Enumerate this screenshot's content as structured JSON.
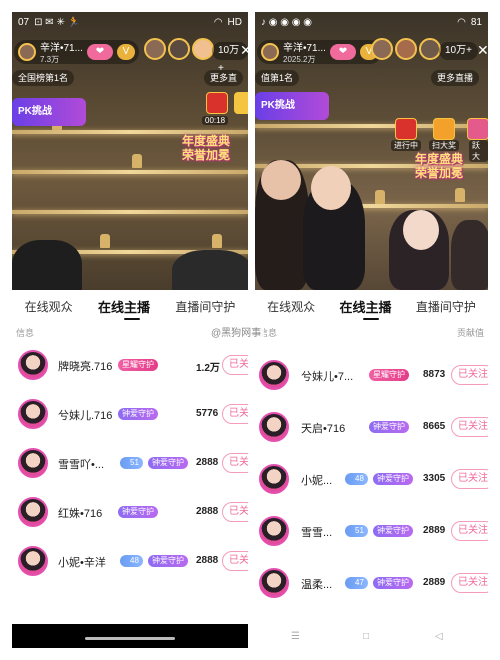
{
  "left": {
    "status": {
      "time": "07",
      "signal": "HD",
      "icons": "⊡ ✉ ✳ 🏃"
    },
    "anchor": {
      "name": "辛洋•71...",
      "heat": "7.3万"
    },
    "viewer_count": "10万+",
    "close_glyph": "✕",
    "rank_label": "全国榜第1名",
    "more_label": "更多直",
    "pk_label": "PK挑战",
    "promo_time": "00:18",
    "festival_line1": "年度盛典",
    "festival_line2": "荣誉加冕",
    "tabs": [
      "在线观众",
      "在线主播",
      "直播间守护"
    ],
    "subheader_left": "信息",
    "rows": [
      {
        "name": "牌晓亮.716",
        "level": "",
        "guard": "星耀守护",
        "guard_type": "star",
        "value": "1.2万",
        "follow": "已关"
      },
      {
        "name": "兮妹儿.716",
        "level": "",
        "guard": "钟爱守护",
        "guard_type": "bell",
        "value": "5776",
        "follow": "已关"
      },
      {
        "name": "雪雪吖•...",
        "level": "51",
        "guard": "钟爱守护",
        "guard_type": "bell",
        "value": "2888",
        "follow": "已关"
      },
      {
        "name": "红姝•716",
        "level": "",
        "guard": "钟爱守护",
        "guard_type": "bell",
        "value": "2888",
        "follow": "已关"
      },
      {
        "name": "小妮•辛洋",
        "level": "48",
        "guard": "钟爱守护",
        "guard_type": "bell",
        "value": "2888",
        "follow": "已关"
      }
    ]
  },
  "right": {
    "status": {
      "signal": "81"
    },
    "anchor": {
      "name": "辛洋•71...",
      "heat": "2025.2万"
    },
    "viewer_count": "10万+",
    "close_glyph": "✕",
    "rank_label": "值第1名",
    "more_label": "更多直播",
    "pk_label": "PK挑战",
    "promo1": "进行中",
    "promo2": "扫大奖",
    "promo3": "跃大",
    "festival_line1": "年度盛典",
    "festival_line2": "荣誉加冕",
    "tabs": [
      "在线观众",
      "在线主播",
      "直播间守护"
    ],
    "subheader_left": "信息",
    "subheader_right": "贡献值",
    "rows": [
      {
        "name": "兮妹儿•7...",
        "level": "",
        "guard": "星耀守护",
        "guard_type": "star",
        "value": "8873",
        "follow": "已关注"
      },
      {
        "name": "天启•716",
        "level": "",
        "guard": "钟爱守护",
        "guard_type": "bell",
        "value": "8665",
        "follow": "已关注"
      },
      {
        "name": "小妮...",
        "level": "48",
        "guard": "钟爱守护",
        "guard_type": "bell",
        "value": "3305",
        "follow": "已关注"
      },
      {
        "name": "雪雪...",
        "level": "51",
        "guard": "钟爱守护",
        "guard_type": "bell",
        "value": "2889",
        "follow": "已关注"
      },
      {
        "name": "温柔...",
        "level": "47",
        "guard": "钟爱守护",
        "guard_type": "bell",
        "value": "2889",
        "follow": "已关注"
      }
    ]
  },
  "watermark": "@黑狗网事",
  "colors": {
    "accent_pink": "#ef6a9b",
    "guard_star": "#e43d8a",
    "guard_bell": "#8d6cf2",
    "level_blue": "#6a9cf3"
  }
}
